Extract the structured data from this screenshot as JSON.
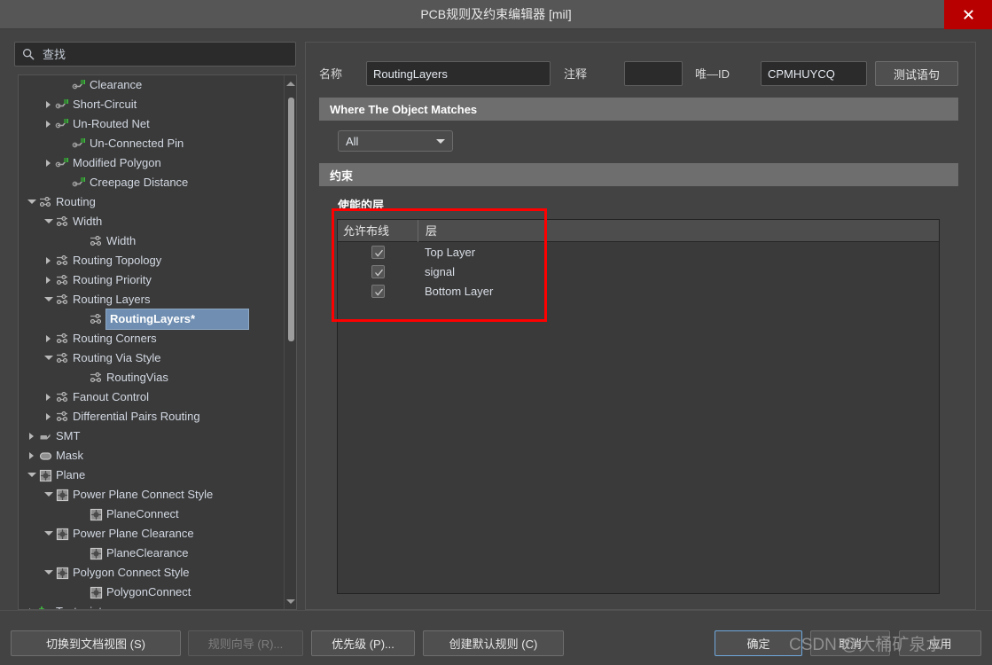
{
  "window": {
    "title": "PCB规则及约束编辑器 [mil]",
    "close_label": "×",
    "close_color": "#b80000"
  },
  "search": {
    "placeholder": "查找",
    "value": "",
    "icon": "search-icon"
  },
  "tree": {
    "scrollbar": {
      "up_icon": "chevron-up-icon",
      "down_icon": "chevron-down-icon"
    },
    "items": [
      {
        "label": "Clearance",
        "indent": 2,
        "arrow": "none",
        "icon": "clearance-icon",
        "selected": false
      },
      {
        "label": "Short-Circuit",
        "indent": 1,
        "arrow": "collapsed",
        "icon": "clearance-icon",
        "selected": false
      },
      {
        "label": "Un-Routed Net",
        "indent": 1,
        "arrow": "collapsed",
        "icon": "clearance-icon",
        "selected": false
      },
      {
        "label": "Un-Connected Pin",
        "indent": 2,
        "arrow": "none",
        "icon": "clearance-icon",
        "selected": false
      },
      {
        "label": "Modified Polygon",
        "indent": 1,
        "arrow": "collapsed",
        "icon": "clearance-icon",
        "selected": false
      },
      {
        "label": "Creepage Distance",
        "indent": 2,
        "arrow": "none",
        "icon": "clearance-icon",
        "selected": false
      },
      {
        "label": "Routing",
        "indent": 0,
        "arrow": "expanded",
        "icon": "routing-icon",
        "selected": false
      },
      {
        "label": "Width",
        "indent": 1,
        "arrow": "expanded",
        "icon": "routing-icon",
        "selected": false
      },
      {
        "label": "Width",
        "indent": 3,
        "arrow": "none",
        "icon": "routing-icon",
        "selected": false
      },
      {
        "label": "Routing Topology",
        "indent": 1,
        "arrow": "collapsed",
        "icon": "routing-icon",
        "selected": false
      },
      {
        "label": "Routing Priority",
        "indent": 1,
        "arrow": "collapsed",
        "icon": "routing-icon",
        "selected": false
      },
      {
        "label": "Routing Layers",
        "indent": 1,
        "arrow": "expanded",
        "icon": "routing-icon",
        "selected": false
      },
      {
        "label": "RoutingLayers*",
        "indent": 3,
        "arrow": "none",
        "icon": "routing-icon",
        "selected": true
      },
      {
        "label": "Routing Corners",
        "indent": 1,
        "arrow": "collapsed",
        "icon": "routing-icon",
        "selected": false
      },
      {
        "label": "Routing Via Style",
        "indent": 1,
        "arrow": "expanded",
        "icon": "routing-icon",
        "selected": false
      },
      {
        "label": "RoutingVias",
        "indent": 3,
        "arrow": "none",
        "icon": "routing-icon",
        "selected": false
      },
      {
        "label": "Fanout Control",
        "indent": 1,
        "arrow": "collapsed",
        "icon": "routing-icon",
        "selected": false
      },
      {
        "label": "Differential Pairs Routing",
        "indent": 1,
        "arrow": "collapsed",
        "icon": "routing-icon",
        "selected": false
      },
      {
        "label": "SMT",
        "indent": 0,
        "arrow": "collapsed",
        "icon": "smt-icon",
        "selected": false
      },
      {
        "label": "Mask",
        "indent": 0,
        "arrow": "collapsed",
        "icon": "mask-icon",
        "selected": false
      },
      {
        "label": "Plane",
        "indent": 0,
        "arrow": "expanded",
        "icon": "plane-icon",
        "selected": false
      },
      {
        "label": "Power Plane Connect Style",
        "indent": 1,
        "arrow": "expanded",
        "icon": "plane-icon",
        "selected": false
      },
      {
        "label": "PlaneConnect",
        "indent": 3,
        "arrow": "none",
        "icon": "plane-icon",
        "selected": false
      },
      {
        "label": "Power Plane Clearance",
        "indent": 1,
        "arrow": "expanded",
        "icon": "plane-icon",
        "selected": false
      },
      {
        "label": "PlaneClearance",
        "indent": 3,
        "arrow": "none",
        "icon": "plane-icon",
        "selected": false
      },
      {
        "label": "Polygon Connect Style",
        "indent": 1,
        "arrow": "expanded",
        "icon": "plane-icon",
        "selected": false
      },
      {
        "label": "PolygonConnect",
        "indent": 3,
        "arrow": "none",
        "icon": "plane-icon",
        "selected": false
      },
      {
        "label": "Testpoint",
        "indent": 0,
        "arrow": "collapsed",
        "icon": "testpoint-icon",
        "selected": false
      }
    ]
  },
  "editor": {
    "name_label": "名称",
    "name_value": "RoutingLayers",
    "comment_label": "注释",
    "comment_value": "",
    "uid_label": "唯—ID",
    "uid_value": "CPMHUYCQ",
    "test_query_button": "测试语句",
    "where_header": "Where The Object Matches",
    "scope_value": "All",
    "constraint_header": "约束",
    "enabled_layers_label": "使能的层"
  },
  "layers_table": {
    "columns": [
      "允许布线",
      "层"
    ],
    "rows": [
      {
        "allowed": true,
        "layer": "Top Layer"
      },
      {
        "allowed": true,
        "layer": "signal"
      },
      {
        "allowed": true,
        "layer": "Bottom Layer"
      }
    ]
  },
  "footer": {
    "switch_to_doc_view": "切换到文档视图 (S)",
    "rule_wizard": "规则向导 (R)...",
    "priority": "优先级 (P)...",
    "create_default_rules": "创建默认规则 (C)",
    "ok": "确定",
    "cancel": "取消",
    "apply": "应用"
  },
  "watermark": {
    "text": "CSDN @大桶矿泉水"
  }
}
